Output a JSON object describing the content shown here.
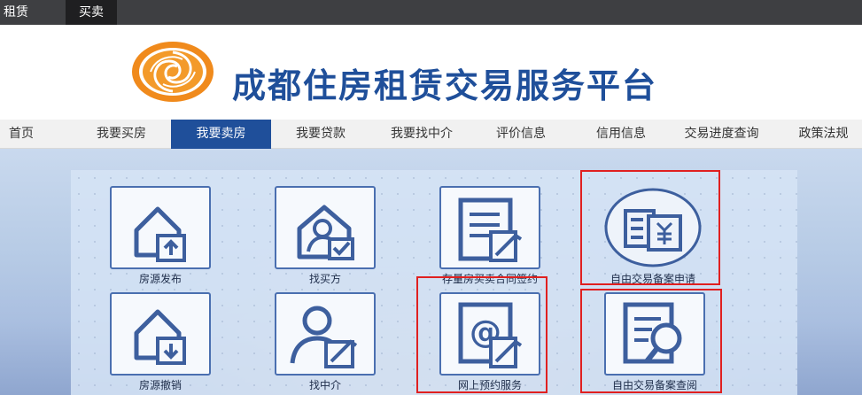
{
  "topbar": {
    "tabs": [
      "租赁",
      "买卖"
    ],
    "active_tab": "买卖"
  },
  "header": {
    "title": "成都住房租赁交易服务平台",
    "logo_icon": "sun-logo-icon"
  },
  "nav": {
    "items": [
      "首页",
      "我要买房",
      "我要卖房",
      "我要贷款",
      "我要找中介",
      "评价信息",
      "信用信息",
      "交易进度查询",
      "政策法规"
    ],
    "active": "我要卖房"
  },
  "services": [
    {
      "label": "房源发布",
      "icon": "house-upload-icon"
    },
    {
      "label": "找买方",
      "icon": "person-check-icon"
    },
    {
      "label": "存量房买卖合同签约",
      "icon": "contract-sign-icon"
    },
    {
      "label": "自由交易备案申请",
      "icon": "filing-application-icon",
      "highlighted": true
    },
    {
      "label": "房源撤销",
      "icon": "house-download-icon"
    },
    {
      "label": "找中介",
      "icon": "person-edit-icon"
    },
    {
      "label": "网上预约服务",
      "icon": "online-appointment-icon",
      "highlighted": true
    },
    {
      "label": "自由交易备案查阅",
      "icon": "filing-search-icon",
      "highlighted": true
    }
  ],
  "colors": {
    "brand_blue": "#1f4f9a",
    "highlight_red": "#e02020",
    "topbar": "#3e3f42"
  }
}
